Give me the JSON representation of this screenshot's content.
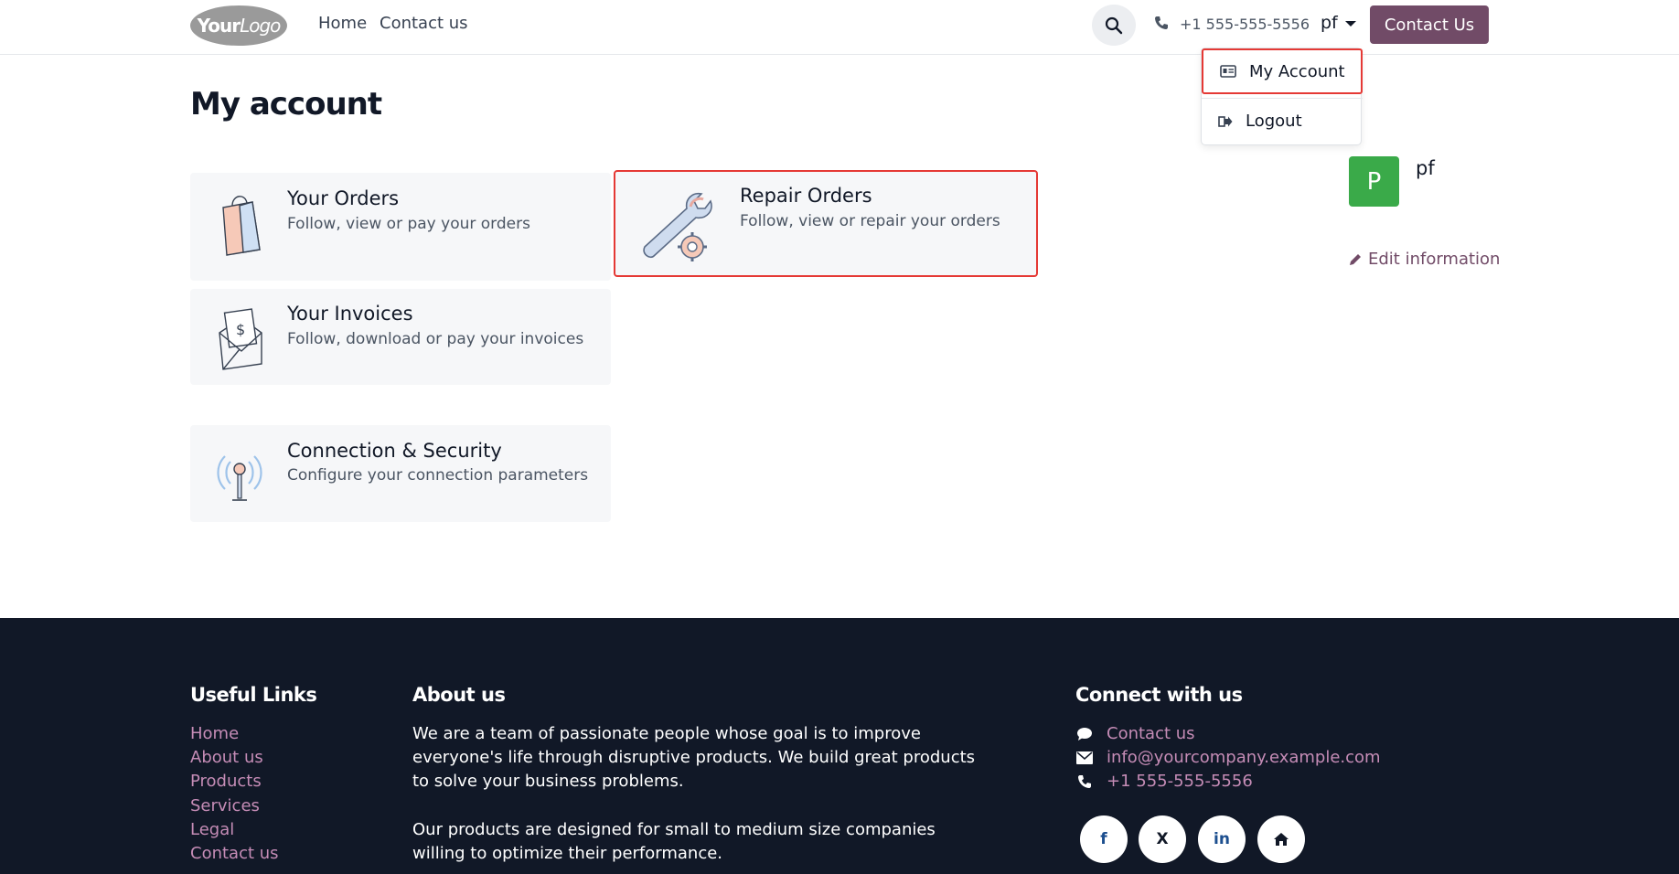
{
  "header": {
    "logo_main": "Your",
    "logo_sub": "Logo",
    "nav": [
      "Home",
      "Contact us"
    ],
    "phone": "+1 555-555-5556",
    "user": "pf",
    "contact_button": "Contact Us"
  },
  "dropdown": {
    "items": [
      "My Account",
      "Logout"
    ]
  },
  "page": {
    "title": "My account"
  },
  "cards": [
    {
      "title": "Your Orders",
      "desc": "Follow, view or pay your orders"
    },
    {
      "title": "Repair Orders",
      "desc": "Follow, view or repair your orders"
    },
    {
      "title": "Your Invoices",
      "desc": "Follow, download or pay your invoices"
    },
    {
      "title": "Connection & Security",
      "desc": "Configure your connection parameters"
    }
  ],
  "profile": {
    "avatar_letter": "P",
    "name": "pf",
    "edit_label": "Edit information"
  },
  "footer": {
    "useful_links_heading": "Useful Links",
    "useful_links": [
      "Home",
      "About us",
      "Products",
      "Services",
      "Legal",
      "Contact us"
    ],
    "about_heading": "About us",
    "about_line1": "We are a team of passionate people whose goal is to improve",
    "about_line2": "everyone's life through disruptive products. We build great products",
    "about_line3": "to solve your business problems.",
    "about_line4": "Our products are designed for small to medium size companies",
    "about_line5": "willing to optimize their performance.",
    "connect_heading": "Connect with us",
    "contact_us": "Contact us",
    "email": "info@yourcompany.example.com",
    "phone": "+1 555-555-5556",
    "social": [
      "f",
      "X",
      "in"
    ]
  },
  "colors": {
    "brand": "#714b67",
    "footer_bg": "#111827",
    "footer_link": "#c58cb6",
    "highlight": "#e53935",
    "avatar": "#3aaa49"
  }
}
